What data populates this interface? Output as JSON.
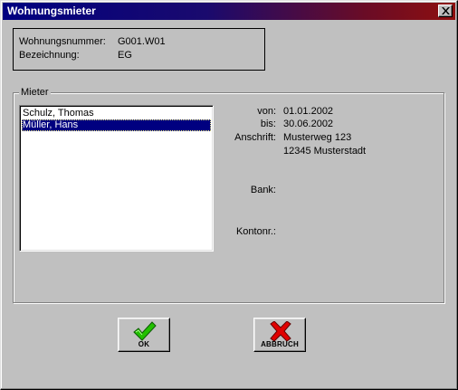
{
  "window": {
    "title": "Wohnungsmieter"
  },
  "info": {
    "wohnungsnummer_label": "Wohnungsnummer:",
    "wohnungsnummer_value": "G001.W01",
    "bezeichnung_label": "Bezeichnung:",
    "bezeichnung_value": "EG"
  },
  "mieter": {
    "group_label": "Mieter",
    "list": [
      "Schulz, Thomas",
      "Müller, Hans"
    ],
    "selected_index": 1,
    "details": {
      "von_label": "von:",
      "von_value": "01.01.2002",
      "bis_label": "bis:",
      "bis_value": "30.06.2002",
      "anschrift_label": "Anschrift:",
      "anschrift_line1": "Musterweg 123",
      "anschrift_line2": "12345 Musterstadt",
      "bank_label": "Bank:",
      "kontonr_label": "Kontonr.:"
    }
  },
  "buttons": {
    "ok_label": "OK",
    "abbruch_label": "ABBRUCH"
  },
  "colors": {
    "ok_check": "#22c000",
    "abbruch_x": "#e00000",
    "selection": "#000080"
  }
}
